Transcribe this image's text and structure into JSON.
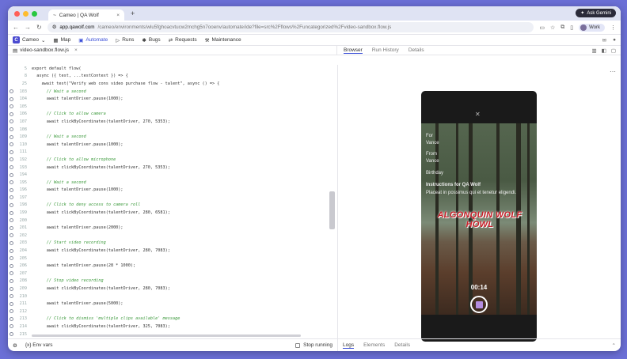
{
  "browser": {
    "tab_title": "Cameo | QA Wolf",
    "tab_close": "×",
    "new_tab": "+",
    "gemini_label": "Ask Gemini",
    "url_host": "app.qawolf.com",
    "url_path": "/cameo/environments/wlu5fghoacvtucw2mchg5n7ooenv/automate/ide?file=src%2Fflows%2Funcategorized%2Fvideo-sandbox.flow.js",
    "profile_label": "Work"
  },
  "appnav": {
    "logo_letter": "C",
    "project": "Cameo",
    "items": [
      "Map",
      "Automate",
      "Runs",
      "Bugs",
      "Requests",
      "Maintenance"
    ]
  },
  "file": {
    "name": "video-sandbox.flow.js",
    "close": "×"
  },
  "right_tabs": [
    "Browser",
    "Run History",
    "Details"
  ],
  "bottom_left": {
    "env_vars": "Env vars",
    "stop_running": "Stop running"
  },
  "bottom_right_tabs": [
    "Logs",
    "Elements",
    "Details"
  ],
  "editor": {
    "lines": [
      {
        "n": "5",
        "code": "export default flow(",
        "type": "code",
        "gut": false
      },
      {
        "n": "8",
        "code": "  async ({ test, ...testContext }) => {",
        "type": "code",
        "gut": false
      },
      {
        "n": "25",
        "code": "    await test(\"Verify web cons video purchase flow - talent\", async () => {",
        "type": "code",
        "gut": false
      },
      {
        "n": "103",
        "code": "      // Wait a second",
        "type": "cmt",
        "gut": true
      },
      {
        "n": "104",
        "code": "      await talentDriver.pause(1000);",
        "type": "code",
        "gut": true
      },
      {
        "n": "105",
        "code": "",
        "type": "code",
        "gut": true
      },
      {
        "n": "106",
        "code": "      // Click to allow camera",
        "type": "cmt",
        "gut": true
      },
      {
        "n": "107",
        "code": "      await clickByCoordinates(talentDriver, 270, 5353);",
        "type": "code",
        "gut": true
      },
      {
        "n": "108",
        "code": "",
        "type": "code",
        "gut": true
      },
      {
        "n": "109",
        "code": "      // Wait a second",
        "type": "cmt",
        "gut": true
      },
      {
        "n": "110",
        "code": "      await talentDriver.pause(1000);",
        "type": "code",
        "gut": true
      },
      {
        "n": "111",
        "code": "",
        "type": "code",
        "gut": true
      },
      {
        "n": "192",
        "code": "      // Click to allow microphone",
        "type": "cmt",
        "gut": true
      },
      {
        "n": "193",
        "code": "      await clickByCoordinates(talentDriver, 270, 5353);",
        "type": "code",
        "gut": true
      },
      {
        "n": "194",
        "code": "",
        "type": "code",
        "gut": true
      },
      {
        "n": "195",
        "code": "      // Wait a second",
        "type": "cmt",
        "gut": true
      },
      {
        "n": "196",
        "code": "      await talentDriver.pause(1000);",
        "type": "code",
        "gut": true
      },
      {
        "n": "197",
        "code": "",
        "type": "code",
        "gut": true
      },
      {
        "n": "198",
        "code": "      // Click to deny access to camera roll",
        "type": "cmt",
        "gut": true
      },
      {
        "n": "199",
        "code": "      await clickByCoordinates(talentDriver, 280, 6581);",
        "type": "code",
        "gut": true
      },
      {
        "n": "200",
        "code": "",
        "type": "code",
        "gut": true
      },
      {
        "n": "201",
        "code": "      await talentDriver.pause(2000);",
        "type": "code",
        "gut": true
      },
      {
        "n": "202",
        "code": "",
        "type": "code",
        "gut": true
      },
      {
        "n": "203",
        "code": "      // Start video recording",
        "type": "cmt",
        "gut": true
      },
      {
        "n": "204",
        "code": "      await clickByCoordinates(talentDriver, 280, 7083);",
        "type": "code",
        "gut": true
      },
      {
        "n": "205",
        "code": "",
        "type": "code",
        "gut": true
      },
      {
        "n": "206",
        "code": "      await talentDriver.pause(28 * 1000);",
        "type": "code",
        "gut": true
      },
      {
        "n": "207",
        "code": "",
        "type": "code",
        "gut": true
      },
      {
        "n": "208",
        "code": "      // Stop video recording",
        "type": "cmt",
        "gut": true
      },
      {
        "n": "209",
        "code": "      await clickByCoordinates(talentDriver, 280, 7083);",
        "type": "code",
        "gut": true
      },
      {
        "n": "210",
        "code": "",
        "type": "code",
        "gut": true
      },
      {
        "n": "211",
        "code": "      await talentDriver.pause(5000);",
        "type": "code",
        "gut": true
      },
      {
        "n": "212",
        "code": "",
        "type": "code",
        "gut": true
      },
      {
        "n": "213",
        "code": "      // Click to dismiss 'multiple clips available' message",
        "type": "cmt",
        "gut": true
      },
      {
        "n": "214",
        "code": "      await clickByCoordinates(talentDriver, 325, 7083);",
        "type": "code",
        "gut": true
      },
      {
        "n": "215",
        "code": "",
        "type": "code",
        "gut": true
      }
    ]
  },
  "phone": {
    "for_label": "For",
    "for_value": "Vance",
    "from_label": "From",
    "from_value": "Vance",
    "birthday": "Birthday",
    "instructions_title": "Instructions for QA Wolf",
    "instructions_text": "Placeat in possimus qui et tenetur eligendi.",
    "banner": "ALGONQUIN WOLF HOWL",
    "timer": "00:14"
  },
  "colors": {
    "accent": "#3b4fd8",
    "desktop": "#6b6fd6",
    "banner_red": "#c8202a",
    "record_button": "#b48de0"
  }
}
